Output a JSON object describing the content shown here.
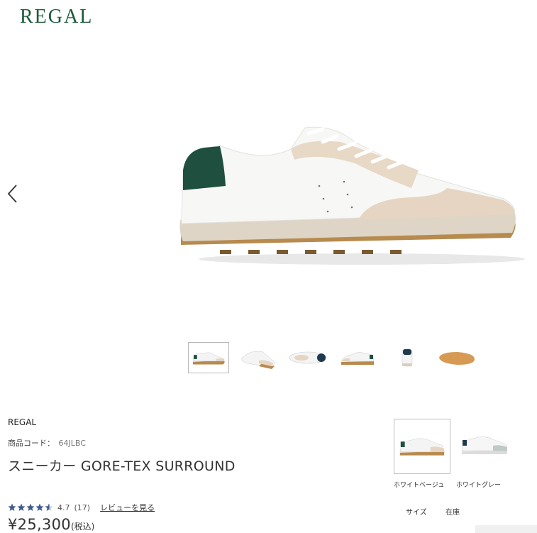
{
  "header": {
    "logo": "REGAL"
  },
  "gallery": {
    "prev_label": "previous-image",
    "thumbnails": [
      {
        "view": "side",
        "active": true
      },
      {
        "view": "angle",
        "active": false
      },
      {
        "view": "top",
        "active": false
      },
      {
        "view": "side-right",
        "active": false
      },
      {
        "view": "back",
        "active": false
      },
      {
        "view": "sole",
        "active": false
      }
    ]
  },
  "product": {
    "brand": "REGAL",
    "code_label": "商品コード：",
    "code_value": "64JLBC",
    "name": "スニーカー GORE-TEX SURROUND",
    "rating_value": "4.7",
    "rating_count": "(17)",
    "rating_stars": 4.5,
    "review_link": "レビューを見る",
    "price": "¥25,300",
    "tax": "(税込)"
  },
  "colors": [
    {
      "label": "ホワイトベージュ",
      "selected": true
    },
    {
      "label": "ホワイトグレー",
      "selected": false
    }
  ],
  "stock_table": {
    "size_header": "サイズ",
    "stock_header": "在庫"
  },
  "theme": {
    "brand_green": "#1d5a3c",
    "star_color": "#3f5b8c"
  }
}
